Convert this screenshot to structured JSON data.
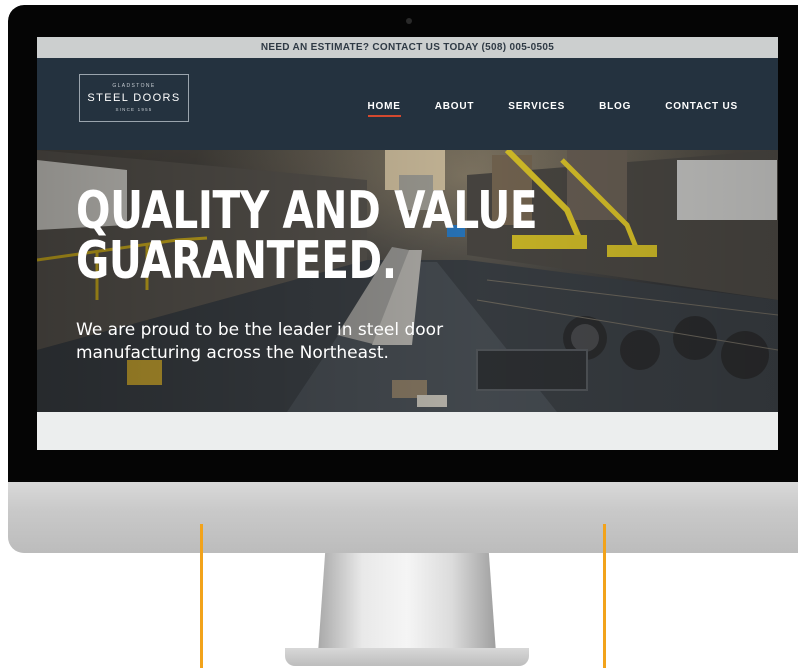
{
  "top_bar": {
    "text": "NEED AN ESTIMATE? CONTACT US TODAY (508) 005-0505"
  },
  "logo": {
    "top": "GLADSTONE",
    "main": "STEEL DOORS",
    "bottom": "SINCE 1955"
  },
  "nav": {
    "items": [
      {
        "label": "HOME",
        "active": true
      },
      {
        "label": "ABOUT",
        "active": false
      },
      {
        "label": "SERVICES",
        "active": false
      },
      {
        "label": "BLOG",
        "active": false
      },
      {
        "label": "CONTACT US",
        "active": false
      }
    ]
  },
  "hero": {
    "title_line1": "QUALITY AND VALUE",
    "title_line2": "GUARANTEED.",
    "subtitle_line1": "We are proud to be the leader in steel door",
    "subtitle_line2": "manufacturing across the Northeast.",
    "image": "factory-floor-photo"
  },
  "colors": {
    "header_bg": "#24323f",
    "top_bar_bg": "#cccfcf",
    "nav_active_underline": "#d4492f",
    "leader_lines": "#f2a31b"
  }
}
